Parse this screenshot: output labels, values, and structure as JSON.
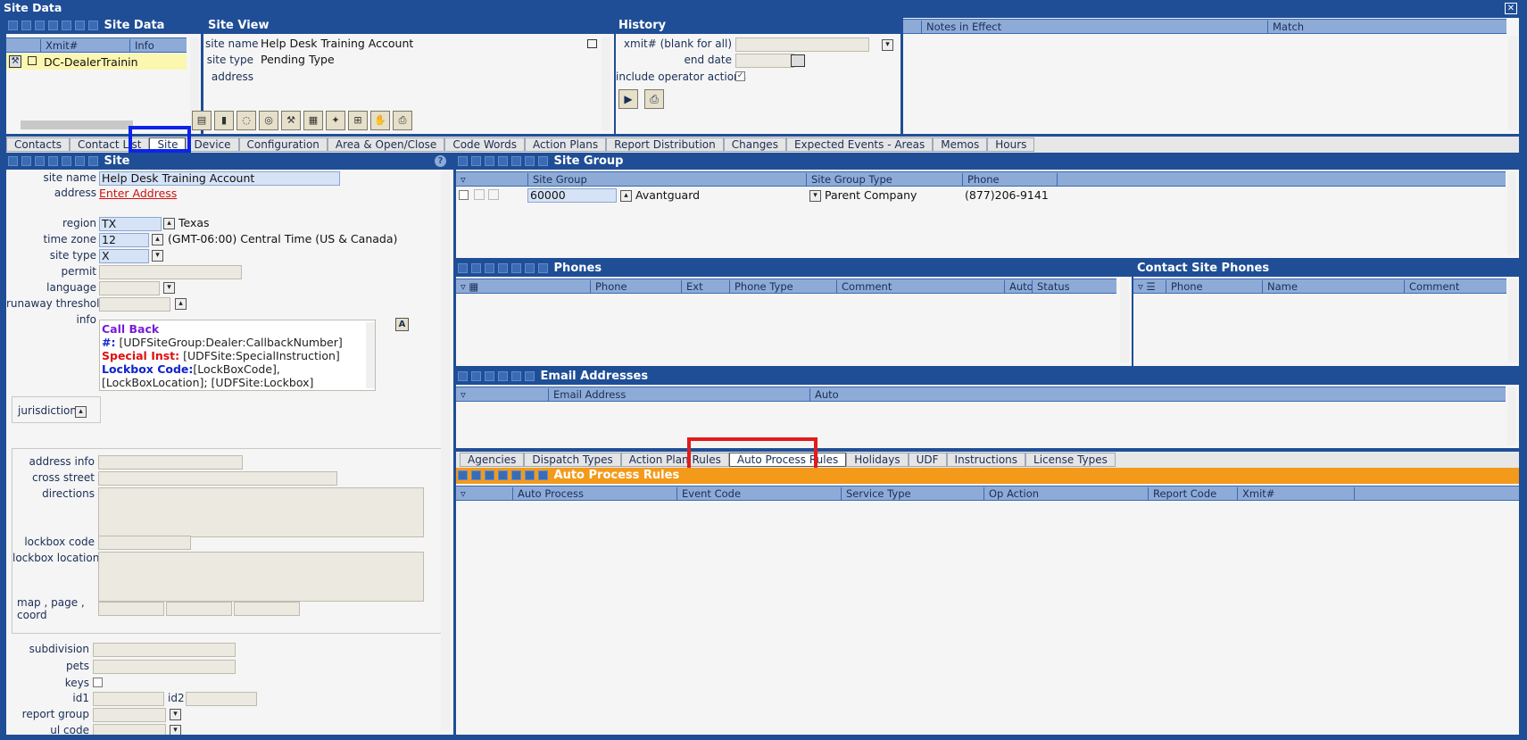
{
  "window": {
    "title": "Site Data",
    "close_glyph": "✕"
  },
  "site_data_panel": {
    "title": "Site Data",
    "col_xmit": "Xmit#",
    "col_info": "Info",
    "row_text": "DC-DealerTrainin"
  },
  "site_view": {
    "title": "Site View",
    "site_name_label": "site name",
    "site_name": "Help Desk Training Account",
    "site_type_label": "site type",
    "site_type": "Pending Type",
    "address_label": "address"
  },
  "history": {
    "title": "History",
    "xmit_label": "xmit#  (blank for all)",
    "end_date_label": "end date",
    "include_label": "include operator actions"
  },
  "notes": {
    "col_notes": "Notes in Effect",
    "col_match": "Match"
  },
  "top_tabs": [
    "Contacts",
    "Contact List",
    "Site",
    "Device",
    "Configuration",
    "Area & Open/Close",
    "Code Words",
    "Action Plans",
    "Report Distribution",
    "Changes",
    "Expected Events - Areas",
    "Memos",
    "Hours"
  ],
  "site_form": {
    "title": "Site",
    "site_name_label": "site name",
    "site_name": "Help Desk Training Account",
    "address_label": "address",
    "address_link": "Enter Address",
    "region_label": "region",
    "region": "TX",
    "region_name": "Texas",
    "time_zone_label": "time zone",
    "time_zone": "12",
    "time_zone_name": "(GMT-06:00) Central Time (US & Canada)",
    "site_type_label": "site type",
    "site_type": "X",
    "permit_label": "permit",
    "language_label": "language",
    "runaway_label": "runaway threshold",
    "info_label": "info",
    "info_lines": [
      {
        "a": "Call Back",
        "b": ""
      },
      {
        "a": "#:",
        "b": " [UDFSiteGroup:Dealer:CallbackNumber]"
      },
      {
        "a": "Special Inst:",
        "b": " [UDFSite:SpecialInstruction]"
      },
      {
        "a": "Lockbox Code:",
        "b": "[LockBoxCode],"
      },
      {
        "a": "",
        "b": "[LockBoxLocation]; [UDFSite:Lockbox]"
      }
    ],
    "jurisdiction_label": "jurisdiction",
    "address_info_label": "address info",
    "cross_street_label": "cross street",
    "directions_label": "directions",
    "lockbox_code_label": "lockbox code",
    "lockbox_location_label": "lockbox location",
    "map_label": "map ,  page ,",
    "coord_label": "coord",
    "subdivision_label": "subdivision",
    "pets_label": "pets",
    "keys_label": "keys",
    "id1_label": "id1",
    "id2_label": "id2",
    "report_group_label": "report group",
    "ul_code_label": "ul code"
  },
  "site_group": {
    "title": "Site Group",
    "cols": [
      "Site Group",
      "Site Group Type",
      "Phone"
    ],
    "row": {
      "code": "60000",
      "name": "Avantguard",
      "type": "Parent Company",
      "phone": "(877)206-9141"
    }
  },
  "phones": {
    "title": "Phones",
    "cols": [
      "Phone",
      "Ext",
      "Phone Type",
      "Comment",
      "Auto",
      "Status"
    ]
  },
  "contact_site_phones": {
    "title": "Contact Site Phones",
    "cols": [
      "Phone",
      "Name",
      "Comment"
    ]
  },
  "email": {
    "title": "Email Addresses",
    "cols": [
      "Email Address",
      "Auto"
    ]
  },
  "bottom_tabs": [
    "Agencies",
    "Dispatch Types",
    "Action Plan Rules",
    "Auto Process Rules",
    "Holidays",
    "UDF",
    "Instructions",
    "License Types"
  ],
  "auto_process": {
    "title": "Auto Process Rules",
    "cols": [
      "Auto Process",
      "Event Code",
      "Service Type",
      "Op Action",
      "Report Code",
      "Xmit#"
    ]
  },
  "colors": {
    "accent": "#1f4e96",
    "header_orange": "#f39a1a",
    "highlight_blue": "#0b24e8",
    "highlight_red": "#e21b1b"
  }
}
